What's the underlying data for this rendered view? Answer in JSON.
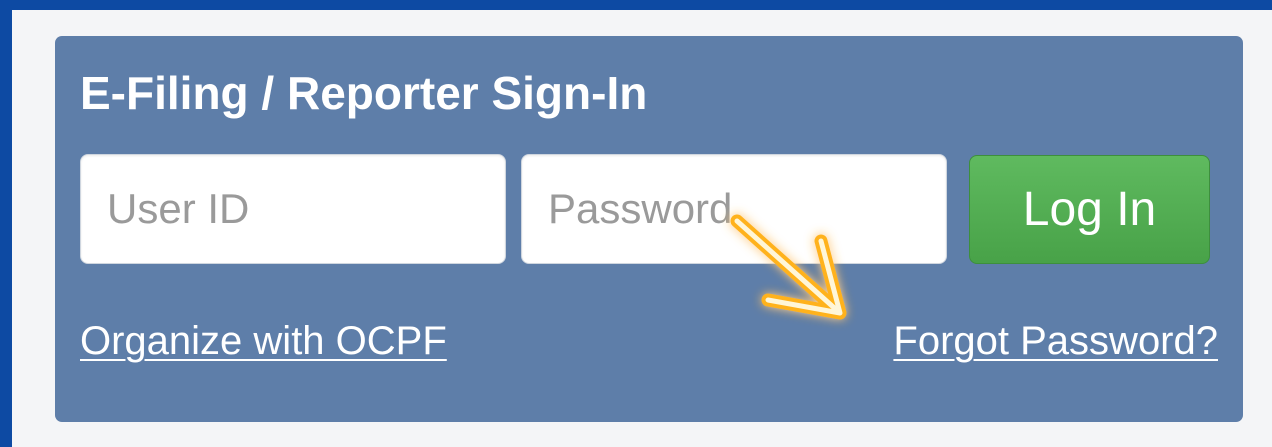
{
  "login_panel": {
    "title": "E-Filing / Reporter Sign-In",
    "user_id_placeholder": "User ID",
    "password_placeholder": "Password",
    "login_label": "Log In",
    "organize_link": "Organize with OCPF",
    "forgot_link": "Forgot Password?"
  },
  "colors": {
    "page_border": "#0d4aa3",
    "panel_background": "#5e7ea9",
    "button_green": "#52ad52",
    "arrow_highlight": "#ffb21a"
  },
  "annotation": {
    "icon": "arrow-pointer-icon"
  }
}
